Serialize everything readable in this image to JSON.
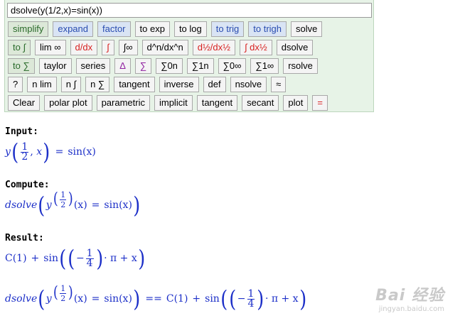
{
  "input": {
    "value": "dsolve(y(1/2,x)=sin(x))"
  },
  "rows": [
    [
      {
        "label": "simplify",
        "s": "g"
      },
      {
        "label": "expand",
        "s": "b"
      },
      {
        "label": "factor",
        "s": "b"
      },
      {
        "label": "to exp",
        "s": ""
      },
      {
        "label": "to log",
        "s": ""
      },
      {
        "label": "to trig",
        "s": "b"
      },
      {
        "label": "to trigh",
        "s": "b"
      },
      {
        "label": "solve",
        "s": ""
      }
    ],
    [
      {
        "label": "to ∫",
        "s": "g"
      },
      {
        "label": "lim ∞",
        "s": ""
      },
      {
        "label": "d/dx",
        "s": "r"
      },
      {
        "label": "∫",
        "s": "r"
      },
      {
        "label": "∫∞",
        "s": ""
      },
      {
        "label": "d^n/dx^n",
        "s": ""
      },
      {
        "label": "d½/dx½",
        "s": "r"
      },
      {
        "label": "∫ dx½",
        "s": "r"
      },
      {
        "label": "dsolve",
        "s": ""
      }
    ],
    [
      {
        "label": "to ∑",
        "s": "g"
      },
      {
        "label": "taylor",
        "s": ""
      },
      {
        "label": "series",
        "s": ""
      },
      {
        "label": "Δ",
        "s": "p"
      },
      {
        "label": "∑",
        "s": "p"
      },
      {
        "label": "∑0n",
        "s": ""
      },
      {
        "label": "∑1n",
        "s": ""
      },
      {
        "label": "∑0∞",
        "s": ""
      },
      {
        "label": "∑1∞",
        "s": ""
      },
      {
        "label": "rsolve",
        "s": ""
      }
    ],
    [
      {
        "label": "?",
        "s": ""
      },
      {
        "label": "n lim",
        "s": ""
      },
      {
        "label": "n ∫",
        "s": ""
      },
      {
        "label": "n ∑",
        "s": ""
      },
      {
        "label": "tangent",
        "s": ""
      },
      {
        "label": "inverse",
        "s": ""
      },
      {
        "label": "def",
        "s": ""
      },
      {
        "label": "nsolve",
        "s": ""
      },
      {
        "label": "≈",
        "s": ""
      }
    ],
    [
      {
        "label": "Clear",
        "s": ""
      },
      {
        "label": "polar plot",
        "s": ""
      },
      {
        "label": "parametric",
        "s": ""
      },
      {
        "label": "implicit",
        "s": ""
      },
      {
        "label": "tangent",
        "s": ""
      },
      {
        "label": "secant",
        "s": ""
      },
      {
        "label": "plot",
        "s": ""
      },
      {
        "label": "=",
        "s": "r"
      }
    ]
  ],
  "labels": {
    "input": "Input:",
    "compute": "Compute:",
    "result": "Result:"
  },
  "math": {
    "y": "y",
    "x": "x",
    "comma": ",",
    "one": "1",
    "two": "2",
    "four": "4",
    "eq": "=",
    "eqeq": "==",
    "sin": "sin",
    "sinx": "sin(x)",
    "dsolve": "dsolve",
    "argx": "(x)",
    "c1": "C(1)",
    "plus": "+",
    "minus": "−",
    "dotpi": "· π",
    "plusx": "+ x"
  },
  "watermark": {
    "logo": "Bai 经验",
    "url": "jingyan.baidu.com"
  }
}
